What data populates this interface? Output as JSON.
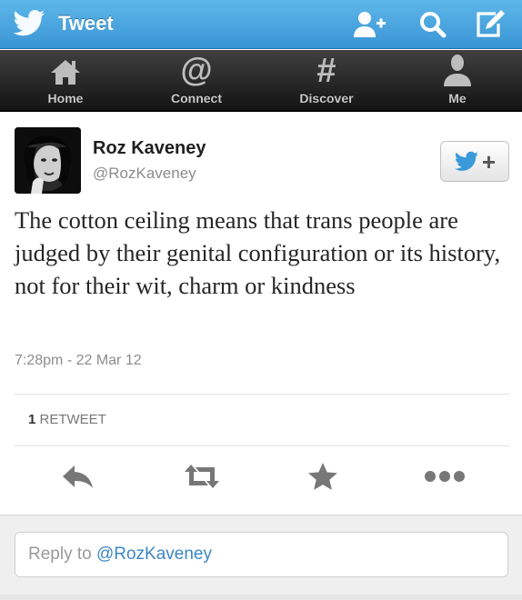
{
  "header": {
    "title": "Tweet",
    "icons": [
      "twitter-bird-icon",
      "add-user-icon",
      "search-icon",
      "compose-icon"
    ]
  },
  "tabs": [
    {
      "label": "Home",
      "icon": "home-icon"
    },
    {
      "label": "Connect",
      "icon": "at-icon"
    },
    {
      "label": "Discover",
      "icon": "hashtag-icon"
    },
    {
      "label": "Me",
      "icon": "person-icon"
    }
  ],
  "tweet": {
    "author_name": "Roz Kaveney",
    "author_handle": "@RozKaveney",
    "text": "The cotton ceiling means that trans people are judged by their genital configuration or its history, not for their wit, charm or kindness",
    "timestamp": "7:28pm - 22 Mar 12",
    "retweet_count": "1",
    "retweet_label": "RETWEET",
    "follow_button_glyph": "+"
  },
  "actions": [
    {
      "name": "reply",
      "icon": "reply-arrow-icon"
    },
    {
      "name": "retweet",
      "icon": "retweet-icon"
    },
    {
      "name": "favorite",
      "icon": "star-icon"
    },
    {
      "name": "more",
      "icon": "ellipsis-icon"
    }
  ],
  "reply": {
    "prefix": "Reply to ",
    "mention": "@RozKaveney"
  },
  "colors": {
    "header_blue": "#3a95d4",
    "tab_bar": "#1e1e1e",
    "link_blue": "#3c86c4"
  }
}
